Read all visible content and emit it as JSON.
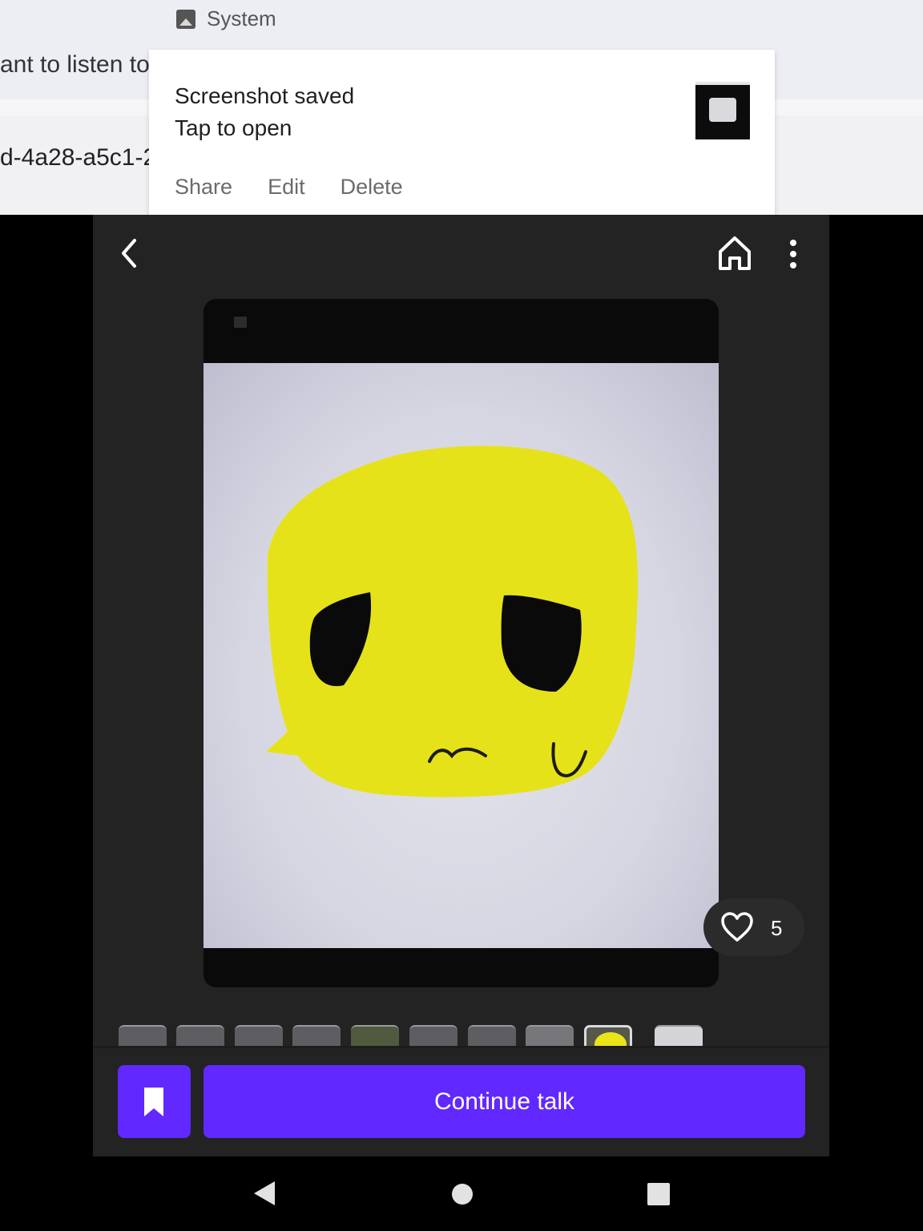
{
  "background_page": {
    "text_line_1": "ant to listen to",
    "text_line_2": "d-4a28-a5c1-2"
  },
  "system_header": {
    "icon": "image-icon",
    "label": "System"
  },
  "notification": {
    "title": "Screenshot saved",
    "subtitle": "Tap to open",
    "actions": [
      "Share",
      "Edit",
      "Delete"
    ],
    "thumbnail_icon": "screenshot-thumbnail"
  },
  "toolbar": {
    "back_icon": "chevron-left-icon",
    "home_icon": "home-icon",
    "more_icon": "more-vertical-icon"
  },
  "post": {
    "image": "yellow-sad-face-drawing",
    "likes": "5",
    "like_icon": "heart-outline-icon",
    "thumbnail_count": 10,
    "active_thumbnail_index": 8
  },
  "bottom_bar": {
    "bookmark_icon": "bookmark-icon",
    "continue_label": "Continue talk"
  },
  "nav_bar": {
    "back_icon": "triangle-back-icon",
    "home_icon": "circle-home-icon",
    "recents_icon": "square-recents-icon"
  },
  "colors": {
    "accent": "#6128ff",
    "app_background": "#232323",
    "face_yellow": "#e6e21a"
  }
}
